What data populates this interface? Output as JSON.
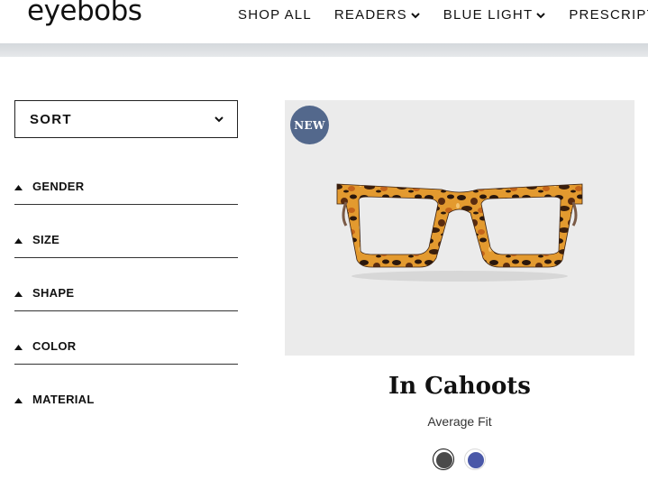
{
  "header": {
    "logo": "eyebobs",
    "nav": [
      "SHOP ALL",
      "READERS",
      "BLUE LIGHT",
      "PRESCRIPT"
    ]
  },
  "sidebar": {
    "sort_label": "SORT",
    "filters": [
      "GENDER",
      "SIZE",
      "SHAPE",
      "COLOR",
      "MATERIAL"
    ]
  },
  "product": {
    "badge": "NEW",
    "name": "In Cahoots",
    "fit": "Average Fit",
    "swatches": [
      {
        "color": "#4a4a4a",
        "selected": true
      },
      {
        "color": "#4a58a8",
        "selected": false
      }
    ]
  },
  "colors": {
    "badge": "#53688c",
    "tortoise_light": "#e39a2f",
    "tortoise_dark": "#2a170c"
  }
}
